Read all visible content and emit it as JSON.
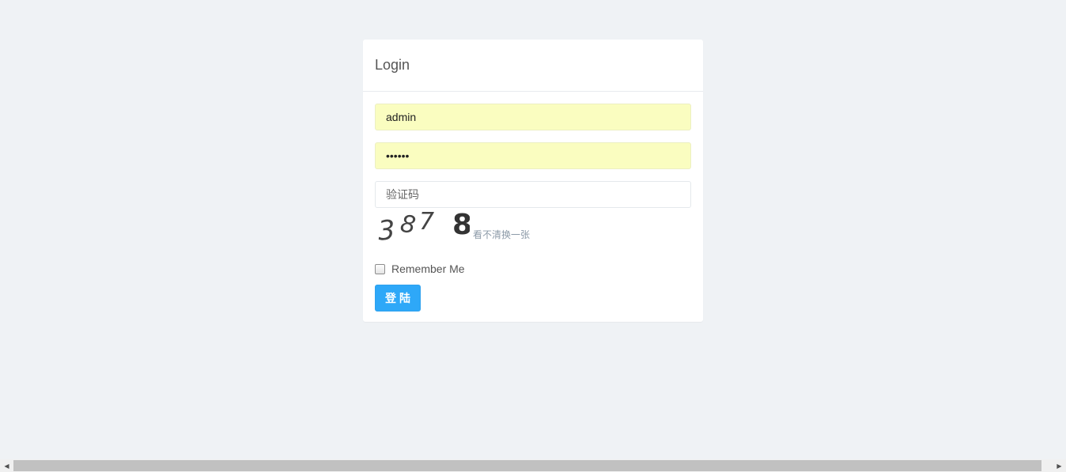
{
  "login": {
    "title": "Login",
    "username_value": "admin",
    "password_value": "••••••",
    "captcha_placeholder": "验证码",
    "captcha_image_text": "3878",
    "captcha_refresh_label": "看不清换一张",
    "remember_label": "Remember Me",
    "submit_label": "登陆"
  },
  "colors": {
    "page_bg": "#eff2f5",
    "autofill_bg": "#fafdc0",
    "button_bg": "#2ea8f8"
  }
}
